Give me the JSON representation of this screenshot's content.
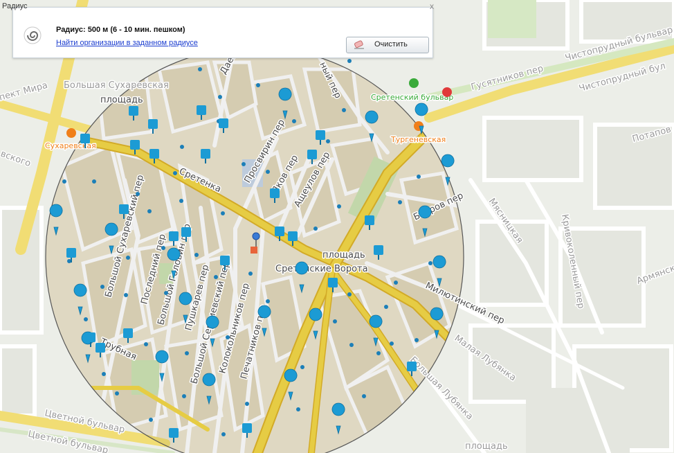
{
  "panel": {
    "title": "Радиус",
    "close_label": "x",
    "radius_text": "Радиус: 500 м (6 - 10 мин. пешком)",
    "find_link": "Найти организации в заданном радиусе",
    "clear_label": "Очистить"
  },
  "map_labels": {
    "bolshaya_sukharevskaya": "Большая Сухаревская",
    "ploshchad_1": "площадь",
    "prospekt_mira": "пект Мира",
    "sukharevskaya": "Сухаревская",
    "vskogo": "вского",
    "sretenka": "Сретенка",
    "prosvirin": "Просвирин пер",
    "yakov": "Яков пер",
    "ashcheulov": "Ащеулов пер",
    "bobrov": "Бобров пер",
    "myasnitskaya": "Мясницкая",
    "krivokolenny": "Кривоколенный пер",
    "armyansky": "Армянск",
    "ploshchad_2": "площадь",
    "sretenskie_vorota": "Сретенские Ворота",
    "milyutinsky": "Милютинский пер",
    "malaya_lubyanka": "Малая Лубянка",
    "bolshaya_lubyanka": "Большая Лубянка",
    "ploshchad_3": "площадь",
    "bolshoy_sukharevsky": "Большой Сухаревский пер",
    "posledny": "Последний пер",
    "bolshoy_golovin": "Большой Головин пер",
    "pushkarev": "Пушкарев пер",
    "bolshoy_sergievsky": "Большой Сергиевский пер",
    "kolokolnikov": "Колокольников пер",
    "pechatnikov": "Печатников пер",
    "trubnaya": "Трубная",
    "tsvetnoy_1": "Цветной бульвар",
    "tsvetnoy_2": "Цветной бульвар",
    "sretensky_bulvar": "Сретенский бульвар",
    "turgenevskaya": "Тургеневская",
    "gusyatnikov": "Гусятников пер",
    "chistoprudny": "Чистопрудный бульвар",
    "chistoprudny_2": "Чистопрудный бул",
    "potapov": "Потапов",
    "daev": "Даев",
    "ny_per": "ный пер"
  },
  "colors": {
    "road_major": "#f5d949",
    "road_major_edge": "#e0b52a",
    "block": "#ece4cc",
    "park": "#cfe5b5",
    "circle_fill": "#000000",
    "pin": "#1c9bd4",
    "metro_green": "#3aaa3a",
    "metro_orange": "#f07f1a",
    "link": "#1a3ccf"
  },
  "icons": {
    "radius_icon": "spiral-icon",
    "clear_icon": "eraser-icon",
    "pin_icon": "map-pin-icon",
    "shop_icon": "shop-marker-icon"
  }
}
